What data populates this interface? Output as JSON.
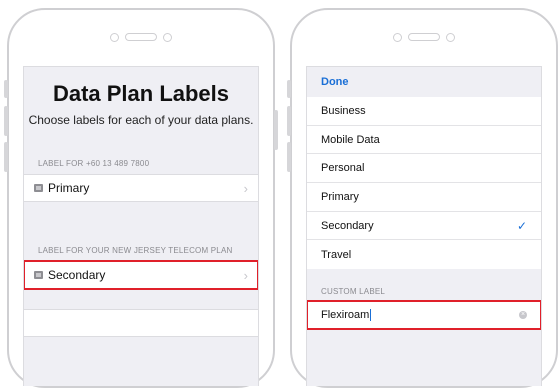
{
  "left_screen": {
    "title": "Data Plan Labels",
    "subtitle": "Choose labels for each of your data plans.",
    "section1_header": "LABEL FOR +60 13 489 7800",
    "section1_value": "Primary",
    "section2_header": "LABEL FOR YOUR NEW JERSEY TELECOM PLAN",
    "section2_value": "Secondary"
  },
  "right_screen": {
    "done_label": "Done",
    "options": [
      {
        "label": "Business",
        "selected": false
      },
      {
        "label": "Mobile Data",
        "selected": false
      },
      {
        "label": "Personal",
        "selected": false
      },
      {
        "label": "Primary",
        "selected": false
      },
      {
        "label": "Secondary",
        "selected": true
      },
      {
        "label": "Travel",
        "selected": false
      }
    ],
    "custom_label_header": "CUSTOM LABEL",
    "custom_label_value": "Flexiroam"
  },
  "colors": {
    "accent": "#1a6fd6",
    "highlight": "#e0202a",
    "background": "#efeff4"
  },
  "icons": [
    "sim-icon",
    "chevron-right-icon",
    "checkmark-icon",
    "clear-icon"
  ]
}
